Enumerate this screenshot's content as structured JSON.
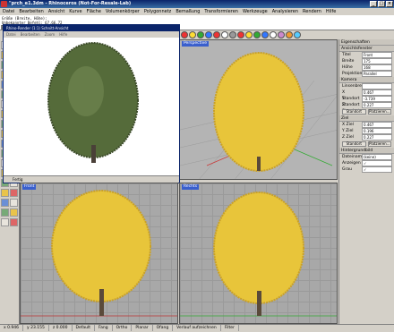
{
  "titlebar": {
    "title": "\"prch_e1.3dm - Rhinoceros (Not-For-Resale-Lab)"
  },
  "menubar": {
    "items": [
      "Datei",
      "Bearbeiten",
      "Ansicht",
      "Kurve",
      "Fläche",
      "Volumenkörper",
      "Polygonnetz",
      "Bemaßung",
      "Transformieren",
      "Werkzeuge",
      "Analysieren",
      "Rendern",
      "Hilfe"
    ]
  },
  "cmdarea": {
    "line1": "Größe (Breite, Höhe):",
    "line2": "Unbekannter Befehl: 67.66,72",
    "prompt": "Befehl:"
  },
  "floatwin": {
    "title": "Rhino-Render (1:1) Schnitt-Ansicht",
    "menu": [
      "Datei",
      "Bearbeiten",
      "Zoom",
      "Hilfe"
    ],
    "status": "Fertig"
  },
  "viewports": [
    {
      "label": "Perspective"
    },
    {
      "label": "Front"
    },
    {
      "label": "Rechts"
    }
  ],
  "rightpanel": {
    "header": "Eigenschaften",
    "section1": "Ansichtsfenster",
    "rows1": [
      {
        "k": "Titel",
        "v": "Front"
      },
      {
        "k": "Breite",
        "v": "175"
      },
      {
        "k": "Höhe",
        "v": "168"
      },
      {
        "k": "Projektion",
        "v": "Parallel"
      }
    ],
    "section2": "Kamera",
    "rows2": [
      {
        "k": "Linsenbrenn.",
        "v": ""
      },
      {
        "k": "X Standort",
        "v": "0.467"
      },
      {
        "k": "Y Standort",
        "v": "-3.739"
      },
      {
        "k": "Z Standort",
        "v": "0.227"
      }
    ],
    "btns1": [
      "Standort",
      "Platzieren..."
    ],
    "section3": "Ziel",
    "rows3": [
      {
        "k": "X Ziel",
        "v": "0.467"
      },
      {
        "k": "Y Ziel",
        "v": "0.196"
      },
      {
        "k": "Z Ziel",
        "v": "0.227"
      }
    ],
    "btns2": [
      "Standort",
      "Platzieren..."
    ],
    "section4": "Hintergrundbild",
    "rows4": [
      {
        "k": "Dateiname",
        "v": "(keine)"
      },
      {
        "k": "Anzeigen",
        "v": "✓"
      },
      {
        "k": "Grau",
        "v": "✓"
      }
    ]
  },
  "statusbar": {
    "items": [
      "x 0.946",
      "y 23.155",
      "z 0.000",
      "Default",
      "Fang",
      "Ortho",
      "Planar",
      "Ofang",
      "Verlauf aufzeichnen",
      "Filter"
    ]
  },
  "colors": {
    "foliage": "#e8c53a",
    "foliage_dark": "#c9a128",
    "floatfoliage": "#556b3a",
    "bark": "#5a4a3a"
  }
}
